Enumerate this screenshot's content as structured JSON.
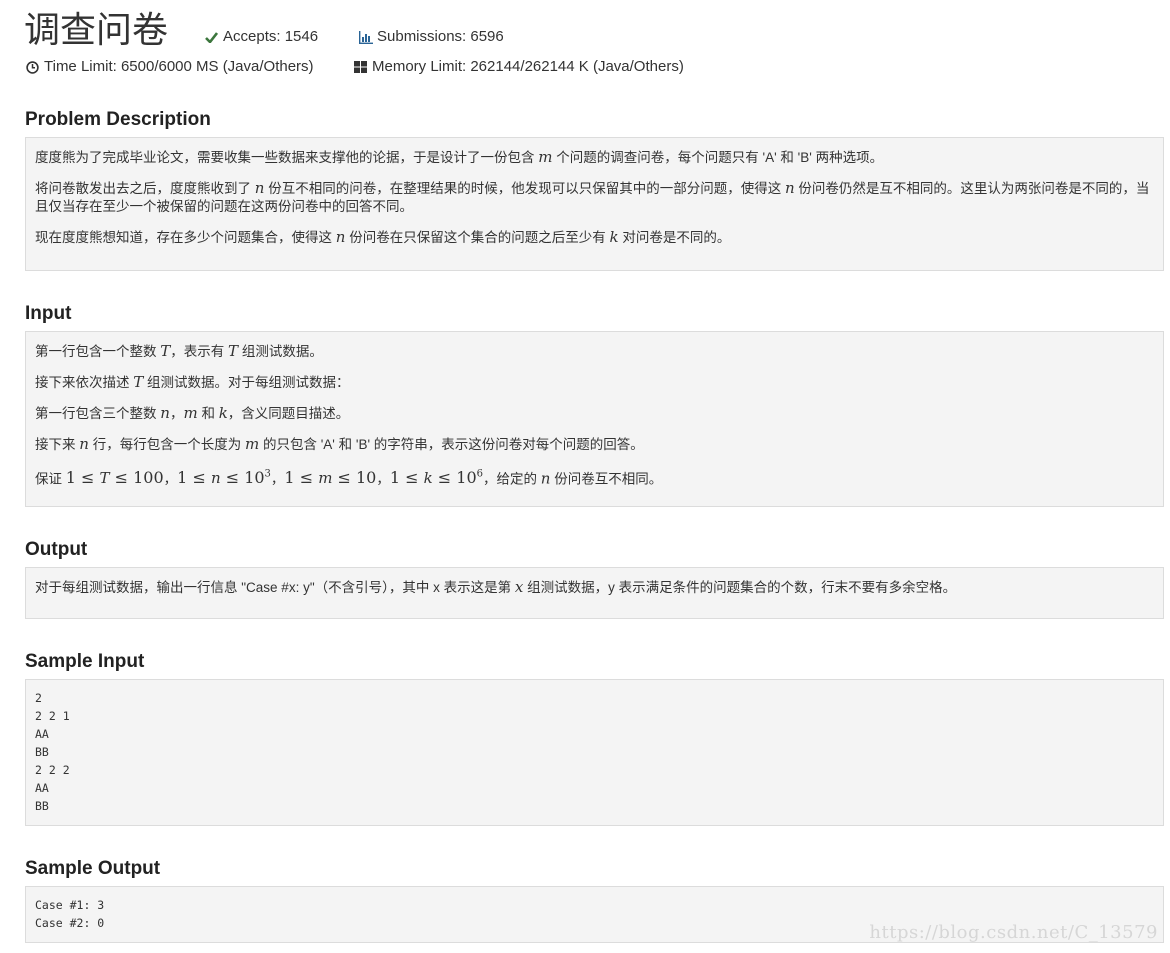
{
  "header": {
    "title": "调查问卷",
    "accepts": "Accepts: 1546",
    "submissions": "Submissions: 6596",
    "time_limit": "Time Limit: 6500/6000 MS (Java/Others)",
    "memory_limit": "Memory Limit: 262144/262144 K (Java/Others)",
    "icons": {
      "accepts": "check-icon",
      "submissions": "bar-chart-icon",
      "time": "clock-icon",
      "memory": "grid-icon"
    },
    "colors": {
      "check": "#3c763d",
      "submissions_icon": "#2a6496"
    }
  },
  "description": {
    "heading": "Problem Description",
    "p1": {
      "a": "度度熊为了完成毕业论文，需要收集一些数据来支撑他的论据，于是设计了一份包含",
      "m": "m",
      "b": "个问题的调查问卷，每个问题只有 'A' 和 'B' 两种选项。"
    },
    "p2": {
      "a": "将问卷散发出去之后，度度熊收到了",
      "n1": "n",
      "b": "份互不相同的问卷，在整理结果的时候，他发现可以只保留其中的一部分问题，使得这",
      "n2": "n",
      "c": "份问卷仍然是互不相同的。这里认为两张问卷是不同的，当且仅当存在至少一个被保留的问题在这两份问卷中的回答不同。"
    },
    "p3": {
      "a": "现在度度熊想知道，存在多少个问题集合，使得这",
      "n": "n",
      "b": "份问卷在只保留这个集合的问题之后至少有",
      "k": "k",
      "c": "对问卷是不同的。"
    }
  },
  "input": {
    "heading": "Input",
    "l1": {
      "a": "第一行包含一个整数",
      "T1": "T",
      "b": "，表示有",
      "T2": "T",
      "c": "组测试数据。"
    },
    "l2": {
      "a": "接下来依次描述",
      "T": "T",
      "b": "组测试数据。对于每组测试数据："
    },
    "l3": {
      "a": "第一行包含三个整数",
      "n": "n",
      "b": "，",
      "m": "m",
      "c": "和",
      "k": "k",
      "d": "，含义同题目描述。"
    },
    "l4": {
      "a": "接下来",
      "n": "n",
      "b": "行，每行包含一个长度为",
      "m": "m",
      "c": "的只包含 'A' 和 'B' 的字符串，表示这份问卷对每个问题的回答。"
    },
    "l5": {
      "a": "保证",
      "c1_pre": "1 ≤ ",
      "c1_var": "T",
      "c1_post": " ≤ 100",
      "sep1": "，",
      "c2_pre": "1 ≤ ",
      "c2_var": "n",
      "c2_mid": " ≤ 10",
      "c2_exp": "3",
      "sep2": "，",
      "c3_pre": "1 ≤ ",
      "c3_var": "m",
      "c3_post": " ≤ 10",
      "sep3": "，",
      "c4_pre": "1 ≤ ",
      "c4_var": "k",
      "c4_mid": " ≤ 10",
      "c4_exp": "6",
      "b": "，给定的",
      "n": "n",
      "c": "份问卷互不相同。"
    }
  },
  "output": {
    "heading": "Output",
    "a": "对于每组测试数据，输出一行信息 \"Case #x: y\"（不含引号），其中 x 表示这是第",
    "x": "x",
    "b": "组测试数据，y 表示满足条件的问题集合的个数，行末不要有多余空格。"
  },
  "sample_input": {
    "heading": "Sample Input",
    "text": "2\n2 2 1\nAA\nBB\n2 2 2\nAA\nBB"
  },
  "sample_output": {
    "heading": "Sample Output",
    "text": "Case #1: 3\nCase #2: 0"
  },
  "watermark": "https://blog.csdn.net/C_13579"
}
